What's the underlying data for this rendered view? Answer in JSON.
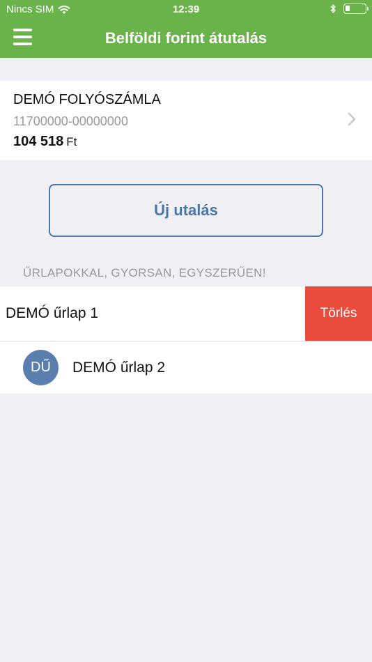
{
  "status_bar": {
    "carrier": "Nincs SIM",
    "time": "12:39",
    "icons": [
      "wifi-icon",
      "bluetooth-icon",
      "battery-icon"
    ]
  },
  "navbar": {
    "title": "Belföldi forint átutalás",
    "menu_icon": "hamburger-menu-icon"
  },
  "account": {
    "name": "DEMÓ FOLYÓSZÁMLA",
    "number": "11700000-00000000",
    "balance": "104 518",
    "currency": "Ft"
  },
  "actions": {
    "new_transfer_label": "Új utalás"
  },
  "forms_section": {
    "header": "ŰRLAPOKKAL, GYORSAN, EGYSZERŰEN!",
    "items": [
      {
        "label": "DEMÓ űrlap 1",
        "delete_label": "Törlés"
      },
      {
        "label": "DEMÓ űrlap 2",
        "initials": "DŰ"
      }
    ]
  },
  "colors": {
    "header_green": "#6ab24a",
    "accent_blue": "#4a76a8",
    "delete_red": "#e94c3d",
    "avatar_blue": "#5a7fae",
    "background": "#efeff4"
  }
}
